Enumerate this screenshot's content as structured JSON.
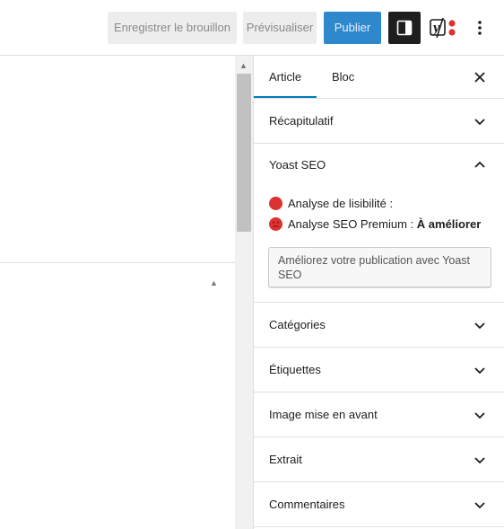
{
  "toolbar": {
    "save_draft_label": "Enregistrer le brouillon",
    "preview_label": "Prévisualiser",
    "publish_label": "Publier",
    "settings_icon": "sidebar-toggle-icon",
    "yoast_icon": "yoast-logo-icon",
    "more_icon": "vertical-ellipsis-icon"
  },
  "sidebar": {
    "tabs": [
      {
        "label": "Article",
        "active": true
      },
      {
        "label": "Bloc",
        "active": false
      }
    ],
    "close_icon": "close-icon",
    "panels": {
      "summary": "Récapitulatif",
      "yoast": "Yoast SEO",
      "categories": "Catégories",
      "tags": "Étiquettes",
      "featured_image": "Image mise en avant",
      "excerpt": "Extrait",
      "comments": "Commentaires"
    },
    "yoast": {
      "readability_label": "Analyse de lisibilité :",
      "seo_label": "Analyse SEO Premium :",
      "seo_value": "À améliorer",
      "improve_button": "Améliorez votre publication avec Yoast SEO",
      "status_color": "#dc3232"
    }
  },
  "colors": {
    "accent": "#007cba",
    "publish_bg": "#2e88cc"
  }
}
